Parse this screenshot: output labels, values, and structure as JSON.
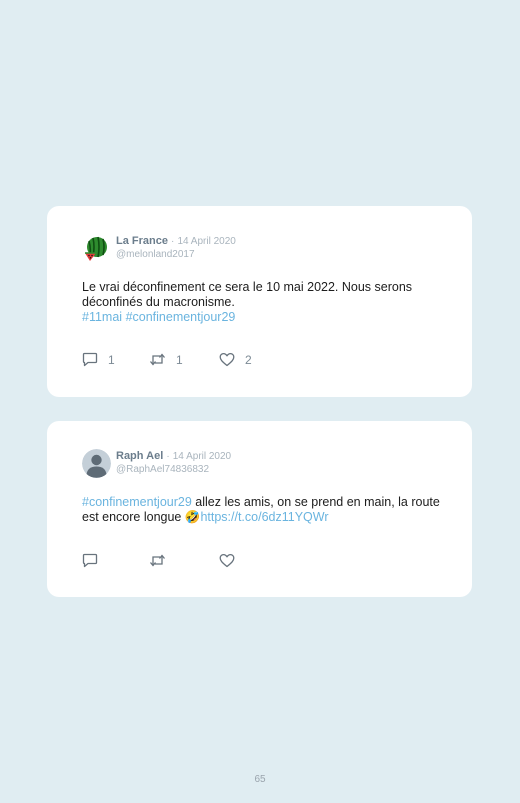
{
  "tweets": [
    {
      "name": "La France",
      "sep": "·",
      "date": "14 April 2020",
      "handle": "@melonland2017",
      "avatar_icon": "watermelon-icon",
      "text": "Le vrai déconfinement ce sera le 10 mai 2022. Nous serons déconfinés du macronisme.",
      "hashtags": [
        "#11mai",
        "#confinementjour29"
      ],
      "replies": "1",
      "retweets": "1",
      "likes": "2"
    },
    {
      "name": "Raph Ael",
      "sep": "·",
      "date": "14 April 2020",
      "handle": "@RaphAel74836832",
      "avatar_icon": "default-user-icon",
      "hashtag": "#confinementjour29",
      "text": " allez les amis, on se prend en main, la route est encore longue ",
      "emoji": "🤣",
      "link": "https://t.co/6dz11YQWr"
    }
  ],
  "page_number": "65",
  "colors": {
    "background": "#e0edf2",
    "card": "#ffffff",
    "link": "#6ab4df",
    "name": "#6b7d8c",
    "muted": "#a9b4bd"
  }
}
